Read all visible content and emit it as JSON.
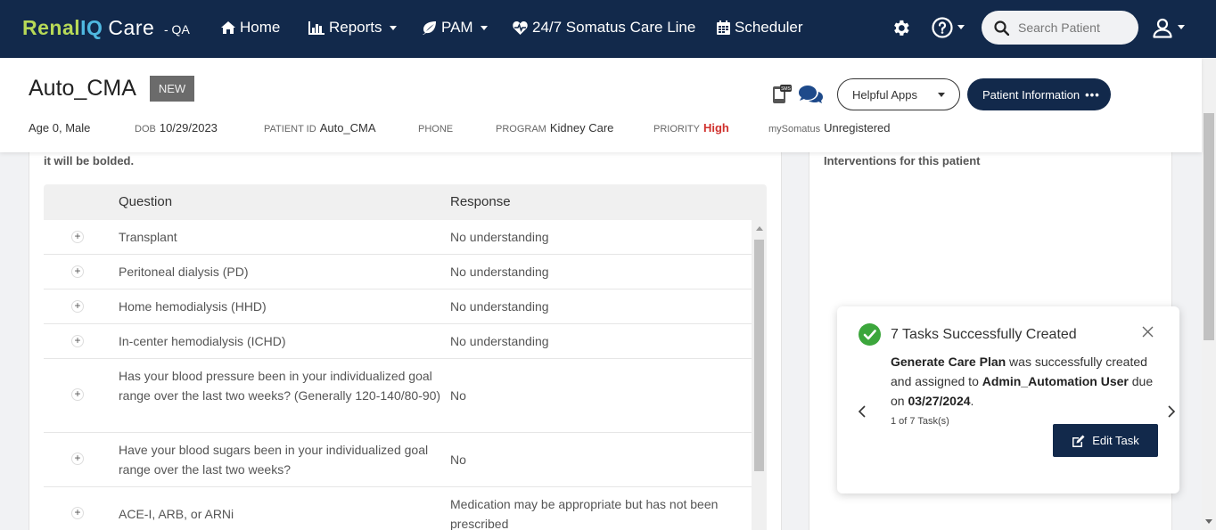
{
  "nav": {
    "logo_renal": "Renal",
    "logo_iq": "IQ",
    "logo_care": "Care",
    "env": "- QA",
    "items": [
      {
        "label": "Home",
        "icon": "home-icon"
      },
      {
        "label": "Reports",
        "icon": "bar-chart-icon"
      },
      {
        "label": "PAM",
        "icon": "leaf-icon"
      },
      {
        "label": "24/7 Somatus Care Line",
        "icon": "heartbeat-icon"
      },
      {
        "label": "Scheduler",
        "icon": "calendar-icon"
      }
    ],
    "search_placeholder": "Search Patient"
  },
  "patient": {
    "name": "Auto_CMA",
    "badge": "NEW",
    "helpful_apps": "Helpful Apps",
    "patient_info_btn": "Patient Information",
    "age_sex": "Age 0, Male",
    "dob_label": "DOB",
    "dob": "10/29/2023",
    "pid_label": "PATIENT ID",
    "pid": "Auto_CMA",
    "phone_label": "PHONE",
    "program_label": "PROGRAM",
    "program": "Kidney Care",
    "priority_label": "PRIORITY",
    "priority": "High",
    "mysomatus_label": "mySomatus",
    "mysomatus": "Unregistered"
  },
  "left_panel": {
    "note": "it will be bolded.",
    "columns": [
      "Question",
      "Response"
    ],
    "rows": [
      {
        "q": "Transplant",
        "r": "No understanding"
      },
      {
        "q": "Peritoneal dialysis (PD)",
        "r": "No understanding"
      },
      {
        "q": "Home hemodialysis (HHD)",
        "r": "No understanding"
      },
      {
        "q": "In-center hemodialysis (ICHD)",
        "r": "No understanding"
      },
      {
        "q": "Has your blood pressure been in your individualized goal range over the last two weeks? (Generally 120-140/80-90)",
        "r": "No"
      },
      {
        "q": "Have your blood sugars been in your individualized goal range over the last two weeks?",
        "r": "No"
      },
      {
        "q": "ACE-I, ARB, or ARNi",
        "r": "Medication may be appropriate but has not been prescribed"
      }
    ]
  },
  "right_panel": {
    "title": "Interventions for this patient"
  },
  "toast": {
    "title": "7 Tasks Successfully Created",
    "task_name": "Generate Care Plan",
    "mid1": " was successfully created and assigned to ",
    "assignee": "Admin_Automation User",
    "mid2": " due on ",
    "due": "03/27/2024",
    "end": ".",
    "count": "1 of 7 Task(s)",
    "edit_label": "Edit Task"
  }
}
